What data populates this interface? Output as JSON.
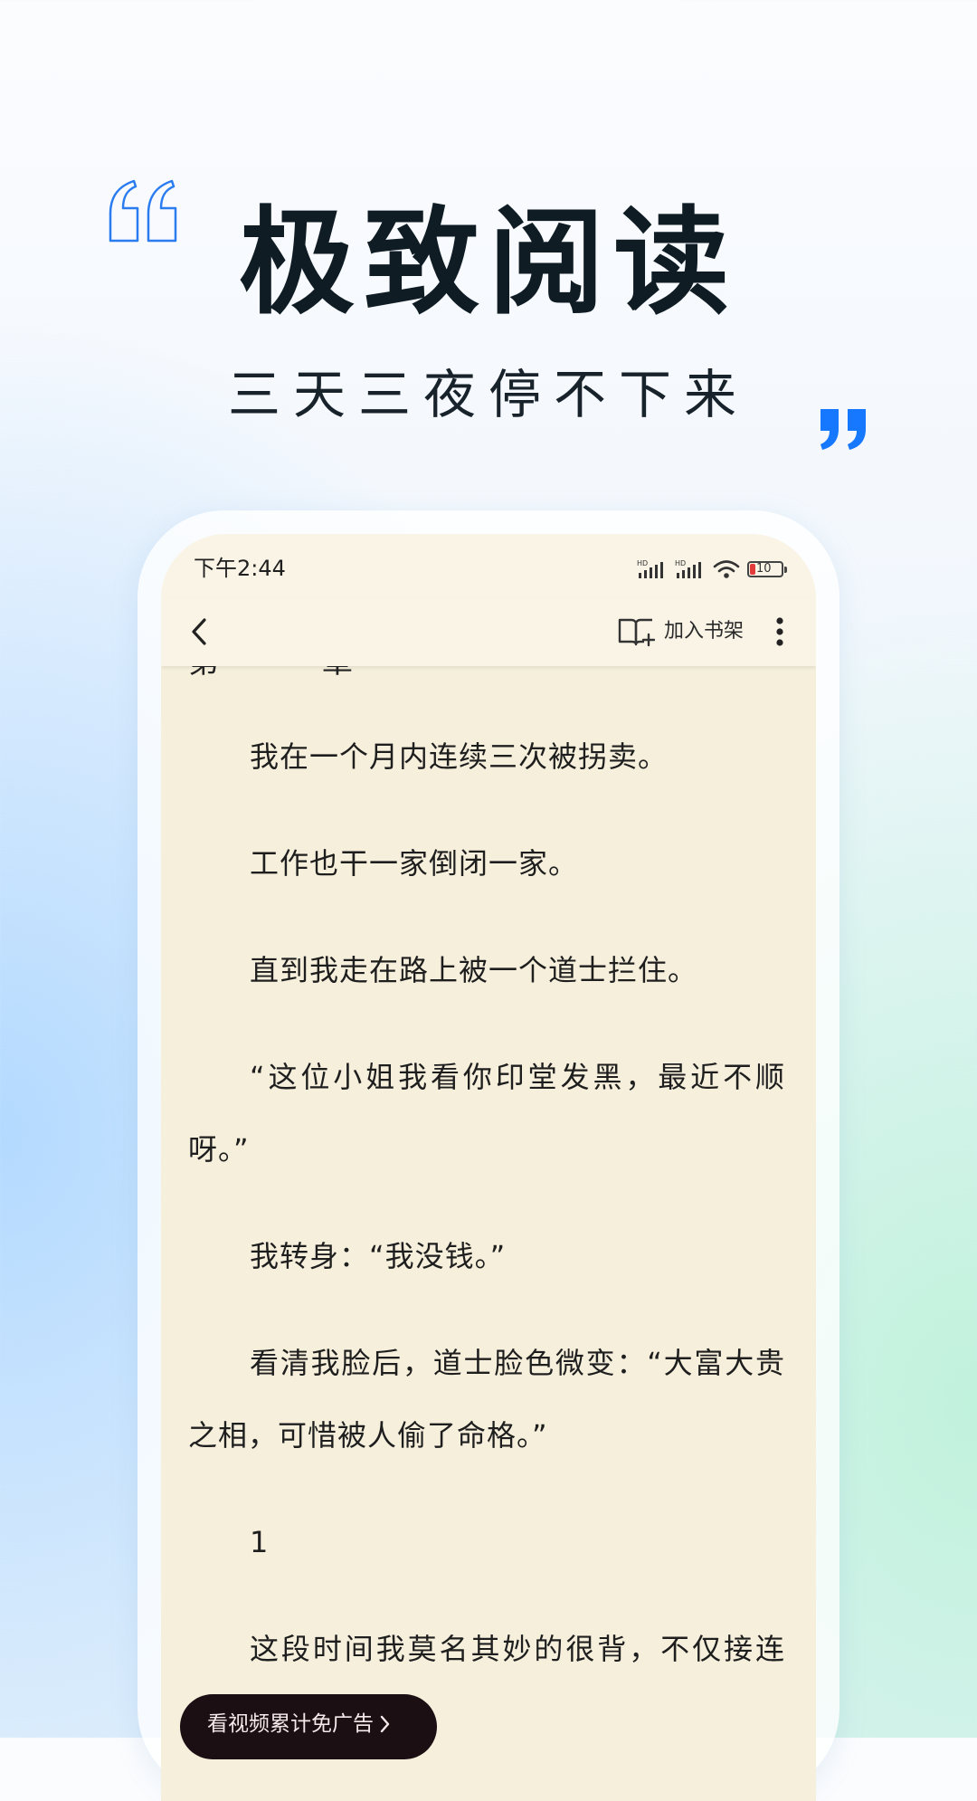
{
  "hero": {
    "title": "极致阅读",
    "subtitle": "三天三夜停不下来"
  },
  "colors": {
    "accent_blue": "#1677ff",
    "paper": "#f5efdc",
    "ad_pill": "#1b0f13"
  },
  "status_bar": {
    "time": "下午2:44",
    "battery_level": "10",
    "icons": [
      "hd-signal-icon",
      "hd-signal-icon",
      "wifi-icon",
      "battery-icon"
    ]
  },
  "toolbar": {
    "back_icon": "chevron-left-icon",
    "shelf_icon": "book-add-icon",
    "add_to_shelf_label": "加入书架",
    "more_icon": "more-vertical-icon"
  },
  "reader": {
    "cut_heading": "第一章",
    "paragraphs": [
      "我在一个月内连续三次被拐卖。",
      "工作也干一家倒闭一家。",
      "直到我走在路上被一个道士拦住。",
      "“这位小姐我看你印堂发黑，最近不顺呀。”",
      "我转身：“我没钱。”",
      "看清我脸后，道士脸色微变：“大富大贵之相，可惜被人偷了命格。”",
      "1",
      "这段时间我莫名其妙的很背，不仅接连的遇到人贩子。"
    ]
  },
  "ad": {
    "label": "看视频累计免广告",
    "icon": "chevron-right-icon"
  }
}
